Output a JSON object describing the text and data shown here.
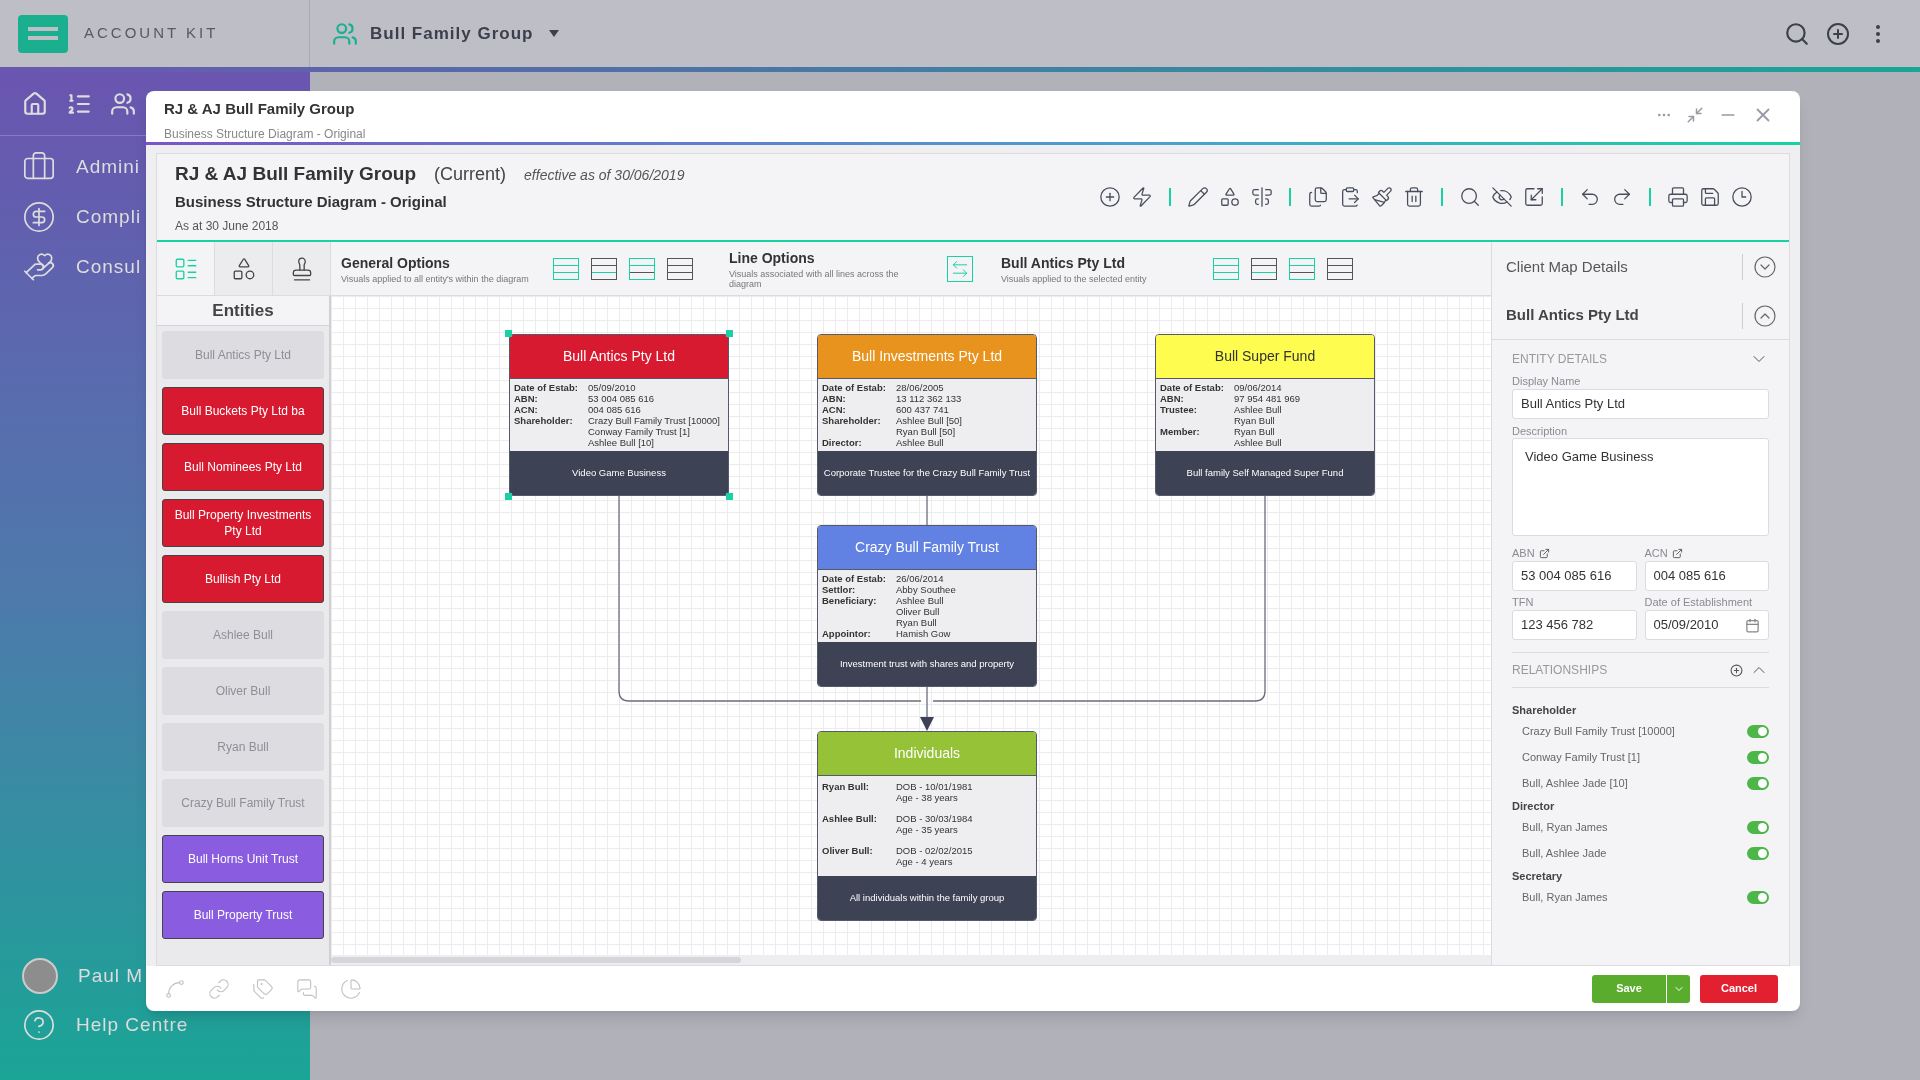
{
  "app": {
    "name": "ACCOUNT KIT",
    "group": "Bull Family Group"
  },
  "nav": [
    {
      "label": "Admini"
    },
    {
      "label": "Compli"
    },
    {
      "label": "Consul"
    }
  ],
  "user": {
    "name": "Paul M"
  },
  "help": {
    "label": "Help Centre"
  },
  "modal": {
    "title": "RJ & AJ Bull Family Group",
    "subtitle": "Business Structure Diagram - Original"
  },
  "diagram": {
    "title": "RJ & AJ Bull Family Group",
    "status": "(Current)",
    "effective": "effective as of 30/06/2019",
    "subtitle": "Business Structure Diagram - Original",
    "as_at": "As at 30 June 2018"
  },
  "side_tabs": [
    {
      "selected": true
    },
    {
      "selected": false
    },
    {
      "selected": false
    }
  ],
  "options": [
    {
      "title": "General Options",
      "description": "Visuals applied to all entity's within the diagram"
    },
    {
      "title": "Line Options",
      "description": "Visuals associated with all lines across the diagram"
    },
    {
      "title": "Bull Antics Pty Ltd",
      "description": "Visuals applied to the selected entity"
    }
  ],
  "entities": {
    "title": "Entities",
    "items": [
      {
        "label": "Bull Antics Pty Ltd",
        "disabled": true
      },
      {
        "label": "Bull Buckets Pty Ltd ba",
        "disabled": false,
        "color": "#d71a2f"
      },
      {
        "label": "Bull Nominees Pty Ltd",
        "disabled": false,
        "color": "#d71a2f"
      },
      {
        "label": "Bull Property Investments Pty Ltd",
        "disabled": false,
        "color": "#d71a2f"
      },
      {
        "label": "Bullish Pty Ltd",
        "disabled": false,
        "color": "#d71a2f"
      },
      {
        "label": "Ashlee Bull",
        "disabled": true
      },
      {
        "label": "Oliver Bull",
        "disabled": true
      },
      {
        "label": "Ryan Bull",
        "disabled": true
      },
      {
        "label": "Crazy Bull Family Trust",
        "disabled": true
      },
      {
        "label": "Bull Horns Unit Trust",
        "disabled": false,
        "color": "#8a5ce0"
      },
      {
        "label": "Bull Property Trust",
        "disabled": false,
        "color": "#8a5ce0"
      }
    ]
  },
  "nodes": [
    {
      "title": "Bull Antics Pty Ltd",
      "color": "#d71a2f",
      "selected": true,
      "fields": [
        {
          "label": "Date of Estab:",
          "values": [
            "05/09/2010"
          ]
        },
        {
          "label": "ABN:",
          "values": [
            "53 004 085 616"
          ]
        },
        {
          "label": "ACN:",
          "values": [
            "004 085 616"
          ]
        },
        {
          "label": "Shareholder:",
          "values": [
            "Crazy Bull Family Trust [10000]",
            "Conway Family Trust [1]",
            "Ashlee Bull [10]"
          ]
        }
      ],
      "footer": "Video Game Business"
    },
    {
      "title": "Bull Investments Pty Ltd",
      "color": "#e8931e",
      "selected": false,
      "fields": [
        {
          "label": "Date of Estab:",
          "values": [
            "28/06/2005"
          ]
        },
        {
          "label": "ABN:",
          "values": [
            "13 112 362 133"
          ]
        },
        {
          "label": "ACN:",
          "values": [
            "600 437 741"
          ]
        },
        {
          "label": "Shareholder:",
          "values": [
            "Ashlee Bull [50]",
            "Ryan Bull [50]"
          ]
        },
        {
          "label": "Director:",
          "values": [
            "Ashlee Bull"
          ]
        }
      ],
      "footer": "Corporate Trustee for the Crazy Bull Family Trust"
    },
    {
      "title": "Bull Super Fund",
      "color": "#fdfc4f",
      "selected": false,
      "fields": [
        {
          "label": "Date of Estab:",
          "values": [
            "09/06/2014"
          ]
        },
        {
          "label": "ABN:",
          "values": [
            "97 954 481 969"
          ]
        },
        {
          "label": "Trustee:",
          "values": [
            "Ashlee Bull",
            "Ryan Bull"
          ]
        },
        {
          "label": "Member:",
          "values": [
            "Ryan Bull",
            "Ashlee Bull"
          ]
        }
      ],
      "footer": "Bull family Self Managed Super Fund"
    },
    {
      "title": "Crazy Bull Family Trust",
      "color": "#6182e2",
      "selected": false,
      "fields": [
        {
          "label": "Date of Estab:",
          "values": [
            "26/06/2014"
          ]
        },
        {
          "label": "Settlor:",
          "values": [
            "Abby Southee"
          ]
        },
        {
          "label": "Beneficiary:",
          "values": [
            "Ashlee Bull",
            "Oliver Bull",
            "Ryan Bull"
          ]
        },
        {
          "label": "Appointor:",
          "values": [
            "Hamish Gow"
          ]
        }
      ],
      "footer": "Investment trust with shares and property"
    },
    {
      "title": "Individuals",
      "color": "#95c236",
      "selected": false,
      "fields": [
        {
          "label": "Ryan Bull:",
          "values": [
            "DOB - 10/01/1981",
            "Age - 38 years"
          ]
        },
        {
          "label": "Ashlee Bull:",
          "values": [
            "DOB - 30/03/1984",
            "Age - 35 years"
          ]
        },
        {
          "label": "Oliver Bull:",
          "values": [
            "DOB - 02/02/2015",
            "Age - 4 years"
          ]
        }
      ],
      "footer": "All individuals within the family group"
    }
  ],
  "panel": {
    "client_map": "Client Map Details",
    "entity": "Bull Antics Pty Ltd",
    "section": "ENTITY DETAILS",
    "display_name": {
      "label": "Display Name",
      "value": "Bull Antics Pty Ltd"
    },
    "description": {
      "label": "Description",
      "value": "Video Game Business"
    },
    "abn": {
      "label": "ABN",
      "value": "53 004 085 616"
    },
    "acn": {
      "label": "ACN",
      "value": "004 085 616"
    },
    "tfn": {
      "label": "TFN",
      "value": "123 456 782"
    },
    "established": {
      "label": "Date of Establishment",
      "value": "05/09/2010"
    },
    "relationships": {
      "title": "RELATIONSHIPS",
      "groups": [
        {
          "role": "Shareholder",
          "items": [
            {
              "label": "Crazy Bull Family Trust [10000]",
              "on": true
            },
            {
              "label": "Conway Family Trust [1]",
              "on": true
            },
            {
              "label": "Bull, Ashlee Jade [10]",
              "on": true
            }
          ]
        },
        {
          "role": "Director",
          "items": [
            {
              "label": "Bull, Ryan James",
              "on": true
            },
            {
              "label": "Bull, Ashlee Jade",
              "on": true
            }
          ]
        },
        {
          "role": "Secretary",
          "items": [
            {
              "label": "Bull, Ryan James",
              "on": true
            }
          ]
        }
      ]
    }
  },
  "footer": {
    "save": "Save",
    "cancel": "Cancel"
  }
}
